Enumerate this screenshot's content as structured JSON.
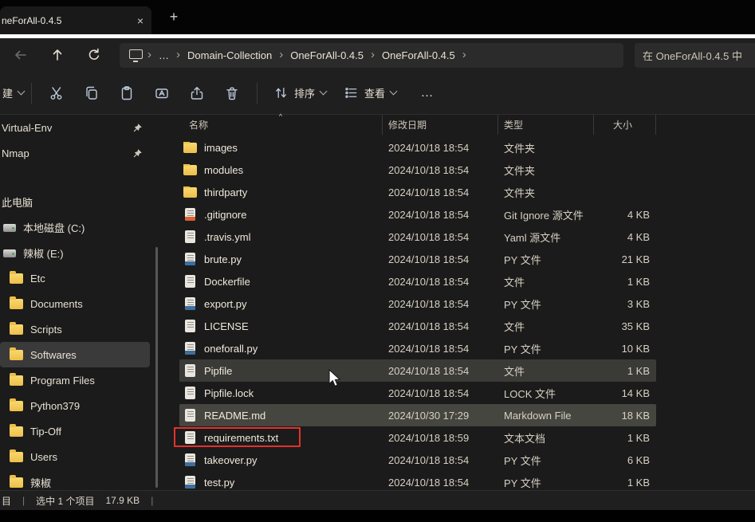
{
  "titlebar": {
    "tab_title": "neForAll-0.4.5",
    "close_icon": "×",
    "new_tab_icon": "+"
  },
  "navbar": {
    "address": {
      "chevron": "›",
      "ellipsis": "…",
      "crumbs": [
        "Domain-Collection",
        "OneForAll-0.4.5",
        "OneForAll-0.4.5"
      ]
    },
    "search_value": "在 OneForAll-0.4.5 中",
    "icons": [
      "back-icon",
      "up-icon",
      "refresh-icon",
      "computer-icon",
      "search-box"
    ]
  },
  "toolbar": {
    "new_label": "建",
    "sort_label": "排序",
    "view_label": "查看",
    "more_icon": "…",
    "icons": [
      "cut-icon",
      "copy-icon",
      "paste-icon",
      "rename-icon",
      "share-icon",
      "delete-icon",
      "sort-icon",
      "view-icon",
      "more-icon"
    ]
  },
  "sidebar": {
    "pinned": [
      {
        "label": "Virtual-Env",
        "icon": "pin"
      },
      {
        "label": "Nmap",
        "icon": "pin"
      }
    ],
    "items": [
      {
        "label": "此电脑",
        "icon": "computer"
      },
      {
        "label": "本地磁盘 (C:)",
        "icon": "drive"
      },
      {
        "label": "辣椒 (E:)",
        "icon": "drive"
      },
      {
        "label": "Etc",
        "icon": "folder"
      },
      {
        "label": "Documents",
        "icon": "folder"
      },
      {
        "label": "Scripts",
        "icon": "folder"
      },
      {
        "label": "Softwares",
        "icon": "folder",
        "selected": true
      },
      {
        "label": "Program Files",
        "icon": "folder"
      },
      {
        "label": "Python379",
        "icon": "folder"
      },
      {
        "label": "Tip-Off",
        "icon": "folder"
      },
      {
        "label": "Users",
        "icon": "folder"
      },
      {
        "label": "辣椒",
        "icon": "folder"
      }
    ]
  },
  "filelist": {
    "columns": {
      "name": "名称",
      "date": "修改日期",
      "type": "类型",
      "size": "大小"
    },
    "sort_indicator": "^",
    "rows": [
      {
        "name": "images",
        "date": "2024/10/18 18:54",
        "type": "文件夹",
        "size": "",
        "icon": "folder-icon"
      },
      {
        "name": "modules",
        "date": "2024/10/18 18:54",
        "type": "文件夹",
        "size": "",
        "icon": "folder-icon"
      },
      {
        "name": "thirdparty",
        "date": "2024/10/18 18:54",
        "type": "文件夹",
        "size": "",
        "icon": "folder-icon"
      },
      {
        "name": ".gitignore",
        "date": "2024/10/18 18:54",
        "type": "Git Ignore 源文件",
        "size": "4 KB",
        "icon": "git-file-icon"
      },
      {
        "name": ".travis.yml",
        "date": "2024/10/18 18:54",
        "type": "Yaml 源文件",
        "size": "4 KB",
        "icon": "yaml-file-icon"
      },
      {
        "name": "brute.py",
        "date": "2024/10/18 18:54",
        "type": "PY 文件",
        "size": "21 KB",
        "icon": "python-file-icon"
      },
      {
        "name": "Dockerfile",
        "date": "2024/10/18 18:54",
        "type": "文件",
        "size": "1 KB",
        "icon": "file-icon"
      },
      {
        "name": "export.py",
        "date": "2024/10/18 18:54",
        "type": "PY 文件",
        "size": "3 KB",
        "icon": "python-file-icon"
      },
      {
        "name": "LICENSE",
        "date": "2024/10/18 18:54",
        "type": "文件",
        "size": "35 KB",
        "icon": "file-icon"
      },
      {
        "name": "oneforall.py",
        "date": "2024/10/18 18:54",
        "type": "PY 文件",
        "size": "10 KB",
        "icon": "python-file-icon"
      },
      {
        "name": "Pipfile",
        "date": "2024/10/18 18:54",
        "type": "文件",
        "size": "1 KB",
        "icon": "file-icon",
        "state": "hover"
      },
      {
        "name": "Pipfile.lock",
        "date": "2024/10/18 18:54",
        "type": "LOCK 文件",
        "size": "14 KB",
        "icon": "lock-file-icon"
      },
      {
        "name": "README.md",
        "date": "2024/10/30 17:29",
        "type": "Markdown File",
        "size": "18 KB",
        "icon": "markdown-file-icon",
        "state": "selected"
      },
      {
        "name": "requirements.txt",
        "date": "2024/10/18 18:59",
        "type": "文本文档",
        "size": "1 KB",
        "icon": "text-file-icon",
        "state": "annotated"
      },
      {
        "name": "takeover.py",
        "date": "2024/10/18 18:54",
        "type": "PY 文件",
        "size": "6 KB",
        "icon": "python-file-icon"
      },
      {
        "name": "test.py",
        "date": "2024/10/18 18:54",
        "type": "PY 文件",
        "size": "1 KB",
        "icon": "python-file-icon"
      }
    ]
  },
  "statusbar": {
    "left_cut": "目",
    "sep": "|",
    "selection": "选中 1 个项目",
    "size": "17.9 KB"
  }
}
